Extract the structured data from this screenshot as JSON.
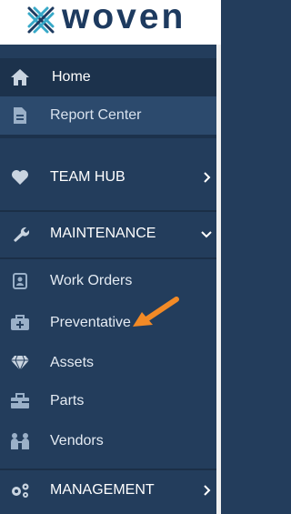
{
  "logo": {
    "text": "woven",
    "mark": "woven-x-mark",
    "color": "#1d3a5f"
  },
  "nav": {
    "home": {
      "label": "Home",
      "icon": "home-icon"
    },
    "report_center": {
      "label": "Report Center",
      "icon": "document-icon"
    },
    "team_hub": {
      "label": "TEAM HUB",
      "icon": "heart-icon",
      "chevron": "chevron-right-icon"
    },
    "maintenance": {
      "label": "MAINTENANCE",
      "icon": "wrench-icon",
      "chevron": "chevron-down-icon",
      "items": [
        {
          "label": "Work Orders",
          "icon": "id-card-icon"
        },
        {
          "label": "Preventative",
          "icon": "first-aid-kit-icon"
        },
        {
          "label": "Assets",
          "icon": "diamond-icon"
        },
        {
          "label": "Parts",
          "icon": "toolbox-icon"
        },
        {
          "label": "Vendors",
          "icon": "people-icon"
        }
      ]
    },
    "management": {
      "label": "MANAGEMENT",
      "icon": "gears-icon",
      "chevron": "chevron-right-icon"
    }
  },
  "colors": {
    "sidebar": "#233d5c",
    "active": "#1c324c",
    "highlight": "#2c4a6d",
    "annotation_arrow": "#f28a26"
  }
}
